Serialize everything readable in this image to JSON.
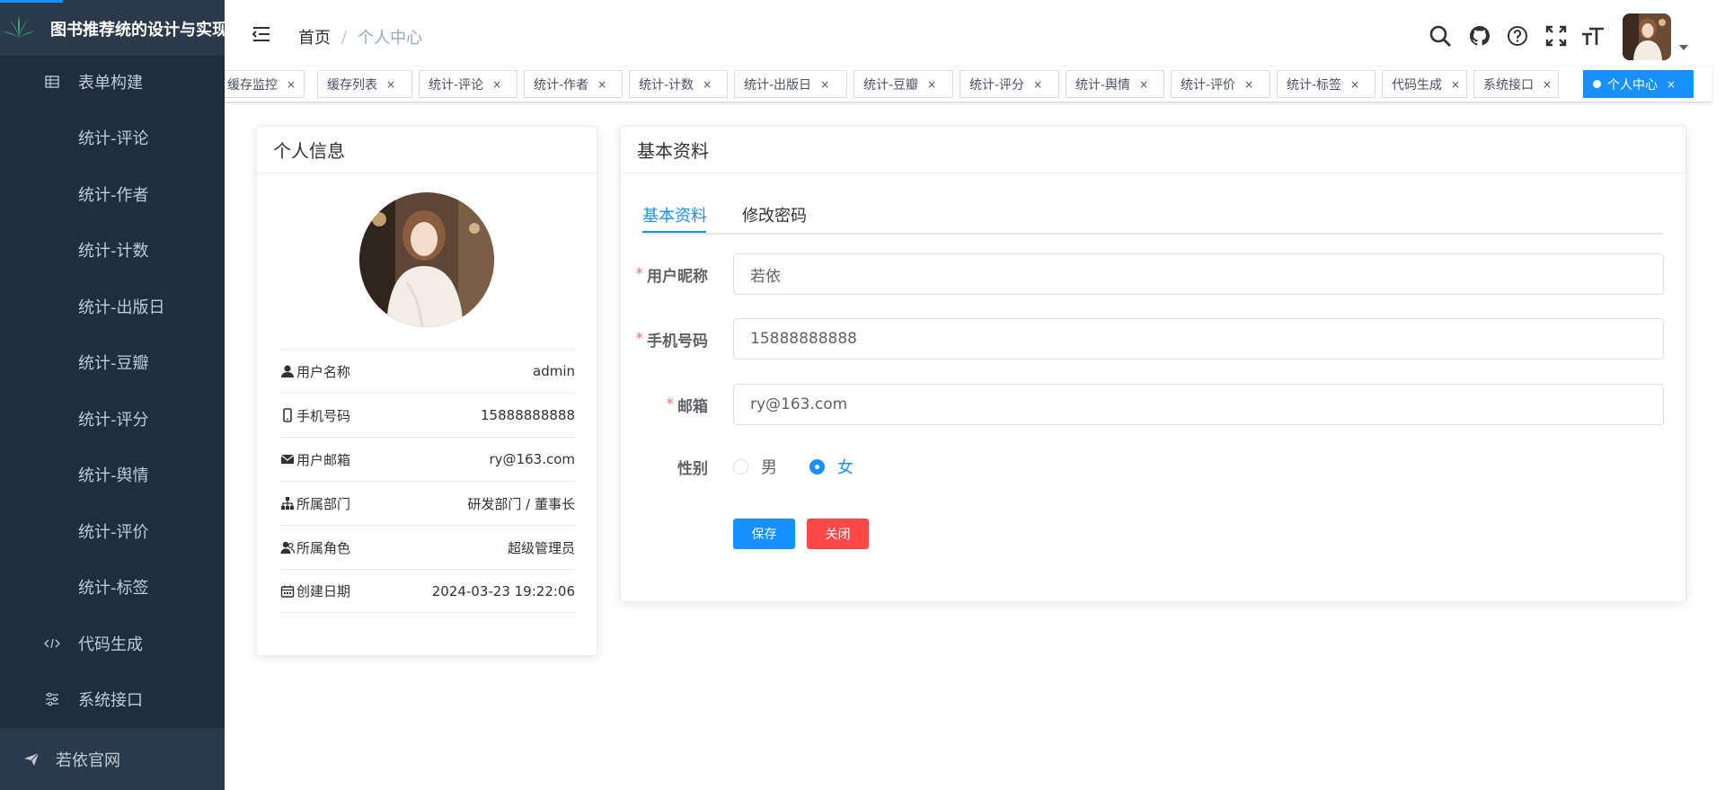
{
  "sidebar": {
    "app_title": "图书推荐统的设计与实现",
    "items": [
      {
        "label": "表单构建",
        "icon": "table-icon"
      },
      {
        "label": "统计-评论"
      },
      {
        "label": "统计-作者"
      },
      {
        "label": "统计-计数"
      },
      {
        "label": "统计-出版日"
      },
      {
        "label": "统计-豆瓣"
      },
      {
        "label": "统计-评分"
      },
      {
        "label": "统计-舆情"
      },
      {
        "label": "统计-评价"
      },
      {
        "label": "统计-标签"
      },
      {
        "label": "代码生成",
        "icon": "code-icon"
      },
      {
        "label": "系统接口",
        "icon": "sliders-icon"
      }
    ],
    "bottom_item": {
      "label": "若依官网",
      "icon": "send-icon"
    }
  },
  "navbar": {
    "breadcrumb": {
      "home": "首页",
      "separator": "/",
      "current": "个人中心"
    }
  },
  "tags": [
    {
      "label": "缓存监控"
    },
    {
      "label": "缓存列表"
    },
    {
      "label": "统计-评论"
    },
    {
      "label": "统计-作者"
    },
    {
      "label": "统计-计数"
    },
    {
      "label": "统计-出版日"
    },
    {
      "label": "统计-豆瓣"
    },
    {
      "label": "统计-评分"
    },
    {
      "label": "统计-舆情"
    },
    {
      "label": "统计-评价"
    },
    {
      "label": "统计-标签"
    },
    {
      "label": "代码生成"
    },
    {
      "label": "系统接口"
    },
    {
      "label": "个人中心",
      "active": true
    }
  ],
  "tag_close": "×",
  "profile": {
    "title": "个人信息",
    "rows": [
      {
        "label": "用户名称",
        "value": "admin"
      },
      {
        "label": "手机号码",
        "value": "15888888888"
      },
      {
        "label": "用户邮箱",
        "value": "ry@163.com"
      },
      {
        "label": "所属部门",
        "value": "研发部门 / 董事长"
      },
      {
        "label": "所属角色",
        "value": "超级管理员"
      },
      {
        "label": "创建日期",
        "value": "2024-03-23 19:22:06"
      }
    ]
  },
  "basic": {
    "title": "基本资料",
    "tabs": [
      {
        "label": "基本资料",
        "active": true
      },
      {
        "label": "修改密码"
      }
    ],
    "fields": {
      "nickname": {
        "label": "用户昵称",
        "value": "若依",
        "required": "*"
      },
      "phone": {
        "label": "手机号码",
        "value": "15888888888",
        "required": "*"
      },
      "email": {
        "label": "邮箱",
        "value": "ry@163.com",
        "required": "*"
      },
      "gender": {
        "label": "性别",
        "options": [
          "男",
          "女"
        ],
        "selected": "女"
      }
    },
    "buttons": {
      "save": "保存",
      "close": "关闭"
    }
  },
  "colors": {
    "primary": "#1890ff",
    "danger": "#ff4949",
    "sidebar_bg": "#1f2d3d"
  }
}
